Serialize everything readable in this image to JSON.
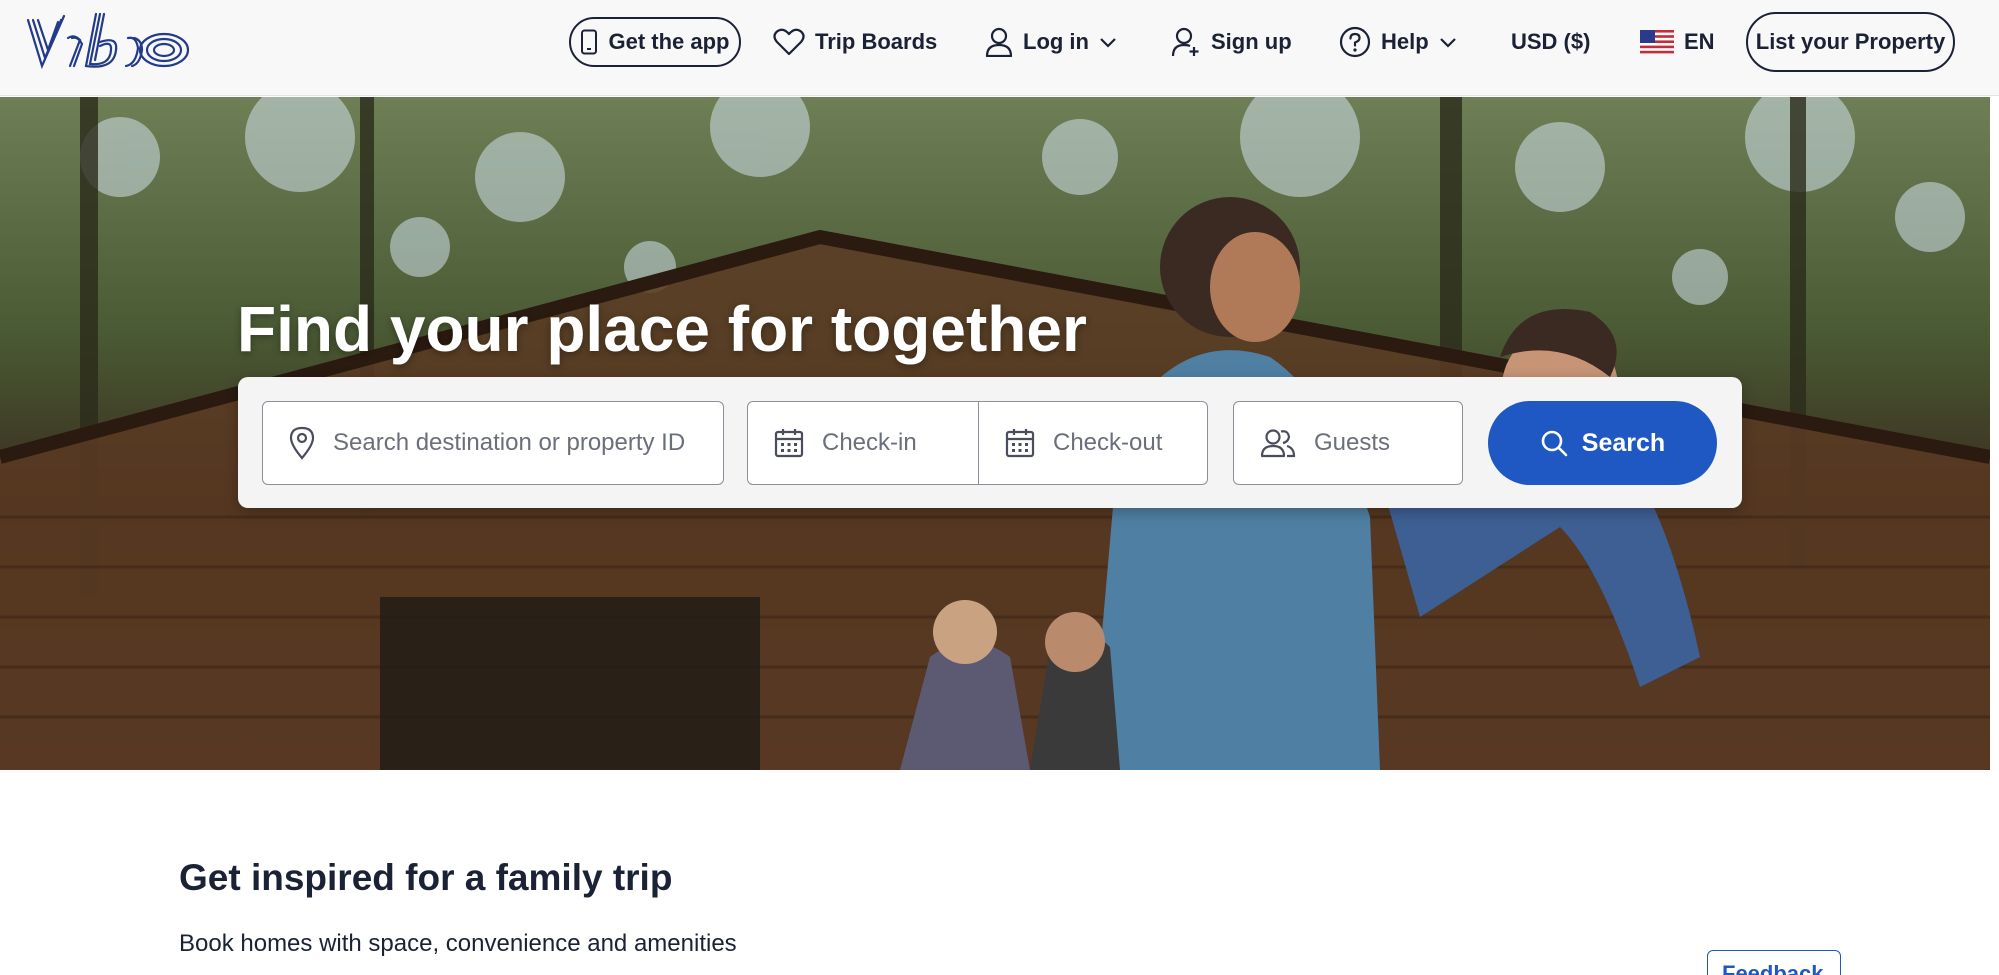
{
  "header": {
    "logo_text": "Vrbo",
    "get_app": "Get the app",
    "trip_boards": "Trip Boards",
    "login": "Log in",
    "signup": "Sign up",
    "help": "Help",
    "currency": "USD ($)",
    "language": "EN",
    "list_property": "List your Property"
  },
  "hero": {
    "title": "Find your place for together"
  },
  "search": {
    "destination_placeholder": "Search destination or property ID",
    "checkin_placeholder": "Check-in",
    "checkout_placeholder": "Check-out",
    "guests_placeholder": "Guests",
    "button_label": "Search"
  },
  "section": {
    "title": "Get inspired for a family trip",
    "subtitle": "Book homes with space, convenience and amenities",
    "feedback_label": "Feedback"
  },
  "colors": {
    "brand_navy": "#1b2236",
    "primary_blue": "#1f57c3",
    "header_bg": "#f8f8f8"
  },
  "icons": [
    "phone-icon",
    "heart-icon",
    "user-icon",
    "chevron-down-icon",
    "user-add-icon",
    "help-icon",
    "us-flag-icon",
    "location-pin-icon",
    "calendar-icon",
    "guests-icon",
    "search-icon"
  ]
}
